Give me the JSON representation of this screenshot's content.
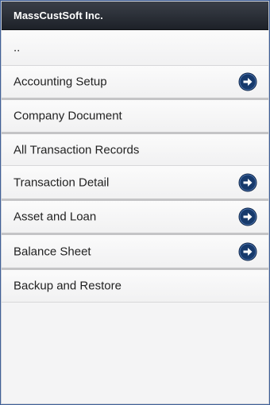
{
  "app": {
    "title": "MassCustSoft Inc."
  },
  "menu": {
    "items": [
      {
        "label": "..",
        "has_arrow": false
      },
      {
        "label": "Accounting Setup",
        "has_arrow": true
      },
      {
        "label": "Company Document",
        "has_arrow": false
      },
      {
        "label": "All Transaction Records",
        "has_arrow": false
      },
      {
        "label": "Transaction Detail",
        "has_arrow": true
      },
      {
        "label": "Asset and Loan",
        "has_arrow": true
      },
      {
        "label": "Balance Sheet",
        "has_arrow": true
      },
      {
        "label": "Backup and Restore",
        "has_arrow": false
      }
    ]
  },
  "icons": {
    "arrow": "arrow-right-circle-icon"
  },
  "colors": {
    "arrow_bg": "#173a6c",
    "header_bg": "#23272e",
    "page_bg": "#3f5f97"
  }
}
